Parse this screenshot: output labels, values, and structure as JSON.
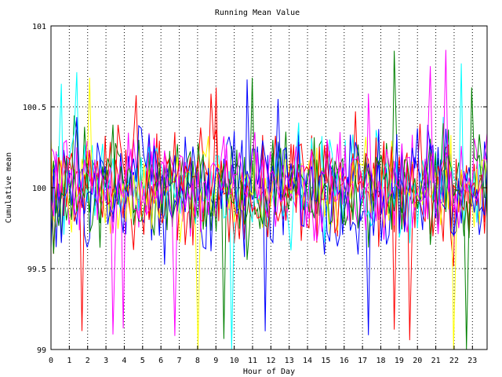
{
  "chart_data": {
    "type": "line",
    "title": "Running Mean Value",
    "xlabel": "Hour of Day",
    "ylabel": "Cumulative mean",
    "xlim": [
      0,
      23.8
    ],
    "ylim": [
      99,
      101
    ],
    "x_ticks": [
      0,
      1,
      2,
      3,
      4,
      5,
      6,
      7,
      8,
      9,
      10,
      11,
      12,
      13,
      14,
      15,
      16,
      17,
      18,
      19,
      20,
      21,
      22,
      23
    ],
    "x_tick_labels": [
      "0",
      "1",
      "2",
      "3",
      "4",
      "5",
      "6",
      "7",
      "8",
      "9",
      "10",
      "11",
      "12",
      "13",
      "14",
      "15",
      "16",
      "17",
      "18",
      "19",
      "20",
      "21",
      "22",
      "23"
    ],
    "y_ticks": [
      99,
      99.5,
      100,
      100.5,
      101
    ],
    "y_tick_labels": [
      "99",
      "99.5",
      "100",
      "100.5",
      "101"
    ],
    "grid": true,
    "legend": "none",
    "series_colors": [
      "#ff0000",
      "#008000",
      "#0000ff",
      "#ff00ff",
      "#00ffff",
      "#ffff00",
      "#ff0000",
      "#0000ff",
      "#008000",
      "#ff00ff"
    ],
    "series": [
      {
        "color": "#ff0000",
        "center": 100.0,
        "spread": 0.38
      },
      {
        "color": "#008000",
        "center": 100.02,
        "spread": 0.38
      },
      {
        "color": "#0000ff",
        "center": 99.98,
        "spread": 0.42
      },
      {
        "color": "#ff00ff",
        "center": 100.0,
        "spread": 0.34
      },
      {
        "color": "#00ffff",
        "center": 100.01,
        "spread": 0.36
      },
      {
        "color": "#ffff00",
        "center": 99.99,
        "spread": 0.34
      },
      {
        "color": "#ff0000",
        "center": 100.0,
        "spread": 0.36
      },
      {
        "color": "#0000ff",
        "center": 100.02,
        "spread": 0.4
      },
      {
        "color": "#008000",
        "center": 99.98,
        "spread": 0.36
      },
      {
        "color": "#ff00ff",
        "center": 100.01,
        "spread": 0.32
      }
    ],
    "approx_range": [
      99,
      100.9
    ]
  }
}
